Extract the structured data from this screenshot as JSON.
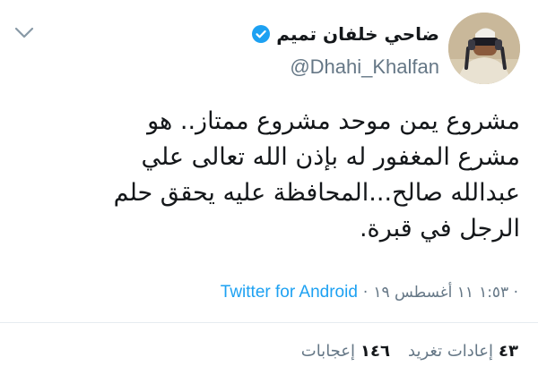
{
  "author": {
    "name": "ضاحي خلفان تميم",
    "handle": "@Dhahi_Khalfan",
    "verified": true
  },
  "tweet": {
    "lines": [
      "مشروع يمن موحد مشروع ممتاز.. هو",
      "مشرع المغفور له بإذن الله تعالى علي",
      "عبدالله صالح...المحافظة عليه يحقق حلم",
      "الرجل في قبرة."
    ]
  },
  "meta": {
    "time": "١:٥٣ ·",
    "date": "١١ أغسطس ١٩",
    "separator": "·",
    "source": "Twitter for Android"
  },
  "stats": {
    "retweets_count": "٤٣",
    "retweets_label": "إعادات تغريد",
    "likes_count": "١٤٦",
    "likes_label": "إعجابات"
  },
  "icons": {
    "menu": "chevron-down-icon",
    "verified": "verified-badge-icon",
    "avatar": "profile-avatar"
  },
  "colors": {
    "link": "#1da1f2",
    "verified": "#1da1f2",
    "muted": "#657786",
    "text": "#14171a"
  }
}
